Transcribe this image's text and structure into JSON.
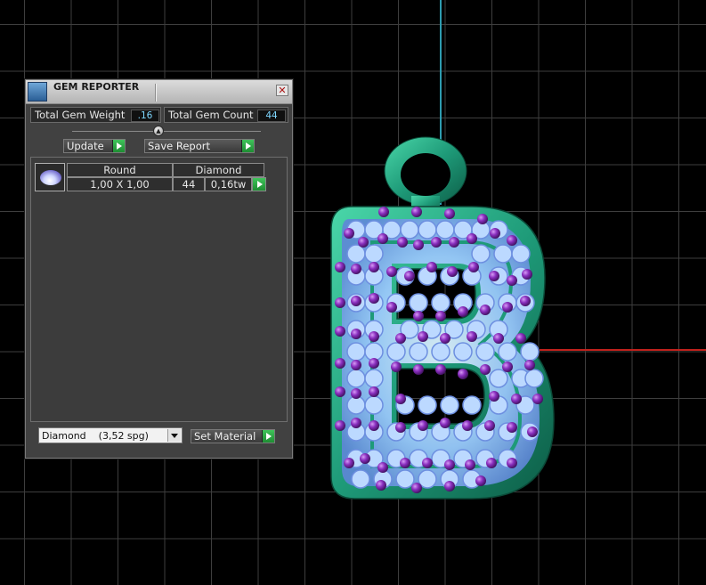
{
  "window": {
    "title": "GEM REPORTER",
    "icon": "gem-report-icon",
    "close_icon": "close-icon",
    "close_glyph": "✕"
  },
  "stats": {
    "weight_label": "Total Gem Weight",
    "weight_value": ".16",
    "count_label": "Total Gem Count",
    "count_value": "44"
  },
  "toolbar": {
    "update_label": "Update",
    "save_label": "Save Report"
  },
  "gem_table": {
    "columns": [
      "Round",
      "Diamond"
    ],
    "rows": [
      {
        "shape": "Round",
        "size": "1,00 X 1,00",
        "material": "Diamond",
        "count": "44",
        "weight": "0,16tw",
        "thumb_icon": "oval-gem-icon"
      }
    ]
  },
  "material": {
    "selected": "Diamond    (3,52 spg)",
    "set_label": "Set Material"
  },
  "viewport": {
    "model": "B",
    "colors": {
      "metal": "#1e9a78",
      "stone": "#9ec8ff",
      "prong": "#7a2aa8",
      "axis_y": "#2e9cb0",
      "axis_x": "#c0211c"
    }
  }
}
